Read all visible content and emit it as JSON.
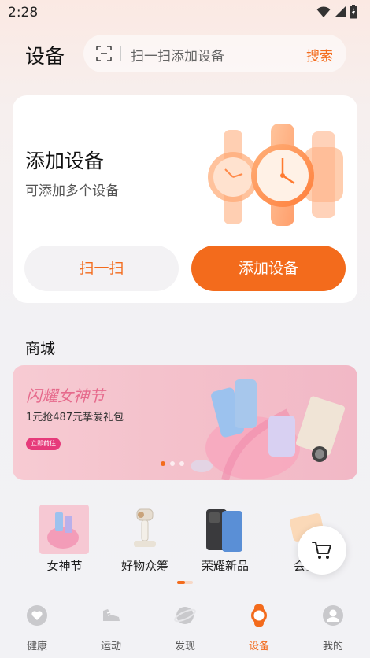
{
  "status_bar": {
    "time": "2:28"
  },
  "header": {
    "title": "设备",
    "search_placeholder": "扫一扫添加设备",
    "search_button": "搜索"
  },
  "add_device_card": {
    "title": "添加设备",
    "subtitle": "可添加多个设备",
    "scan_label": "扫一扫",
    "add_label": "添加设备"
  },
  "mall": {
    "title": "商城",
    "banner": {
      "title": "闪耀女神节",
      "subtitle": "1元抢487元挚爱礼包",
      "cta": "立即前往",
      "slide_count": 3,
      "active_slide": 1
    },
    "shortcuts": [
      {
        "label": "女神节",
        "icon": "goddess-festival-thumb"
      },
      {
        "label": "好物众筹",
        "icon": "crowdfunding-thumb"
      },
      {
        "label": "荣耀新品",
        "icon": "new-phone-thumb"
      },
      {
        "label": "会员",
        "icon": "member-thumb"
      }
    ]
  },
  "tab_bar": {
    "tabs": [
      {
        "label": "健康",
        "icon": "heart-icon",
        "active": false
      },
      {
        "label": "运动",
        "icon": "shoe-icon",
        "active": false
      },
      {
        "label": "发现",
        "icon": "planet-icon",
        "active": false
      },
      {
        "label": "设备",
        "icon": "watch-icon",
        "active": true
      },
      {
        "label": "我的",
        "icon": "profile-icon",
        "active": false
      }
    ]
  },
  "colors": {
    "accent": "#f36b1c",
    "promo_pink": "#e66a8c"
  }
}
